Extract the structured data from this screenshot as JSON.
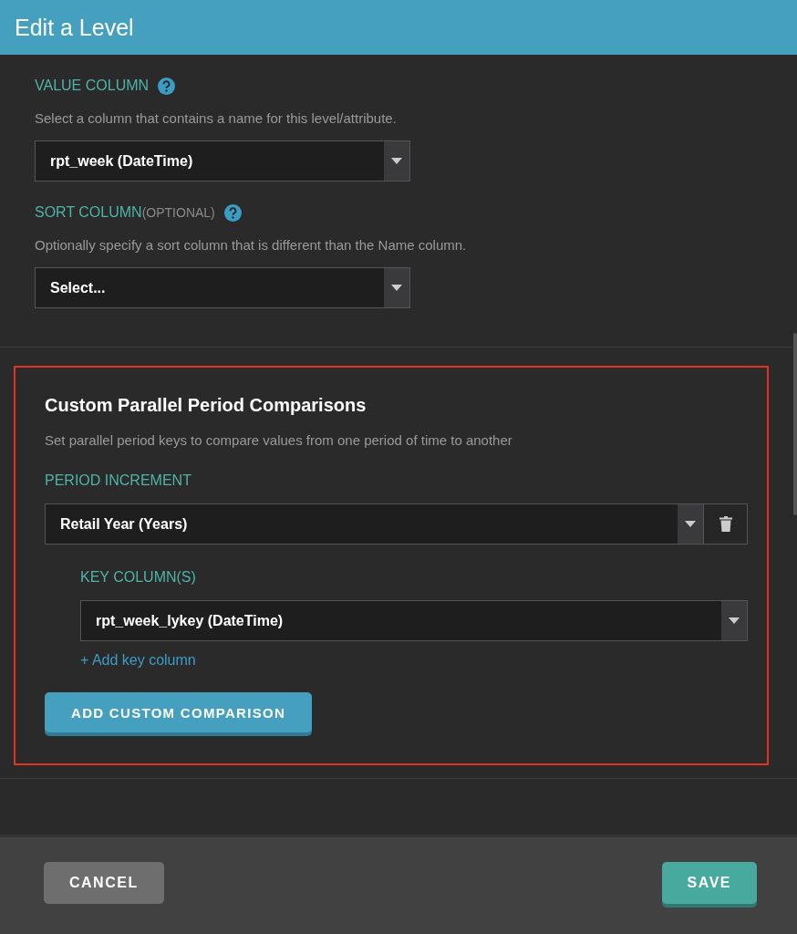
{
  "dialog": {
    "title": "Edit a Level"
  },
  "fields": [
    {
      "label": "VALUE COLUMN",
      "help": true,
      "description": "Select a column that contains a name for this level/attribute.",
      "select": {
        "value": "rpt_week (DateTime)"
      }
    },
    {
      "label": "SORT COLUMN",
      "label_suffix": "(OPTIONAL)",
      "help": true,
      "description": "Optionally specify a sort column that is different than the Name column.",
      "select": {
        "value": "Select..."
      }
    }
  ],
  "comparisons": {
    "highlighted": true,
    "title": "Custom Parallel Period Comparisons",
    "description": "Set parallel period keys to compare values from one period of time to another",
    "period_label": "PERIOD INCREMENT",
    "period_select": {
      "value": "Retail Year (Years)"
    },
    "key_label": "KEY COLUMN(S)",
    "key_selects": [
      {
        "value": "rpt_week_lykey (DateTime)"
      }
    ],
    "add_key_link": "+ Add key column",
    "add_button": "ADD CUSTOM COMPARISON"
  },
  "footer": {
    "buttons": [
      {
        "label": "CANCEL",
        "kind": "secondary"
      },
      {
        "label": "SAVE",
        "kind": "primary"
      }
    ]
  }
}
